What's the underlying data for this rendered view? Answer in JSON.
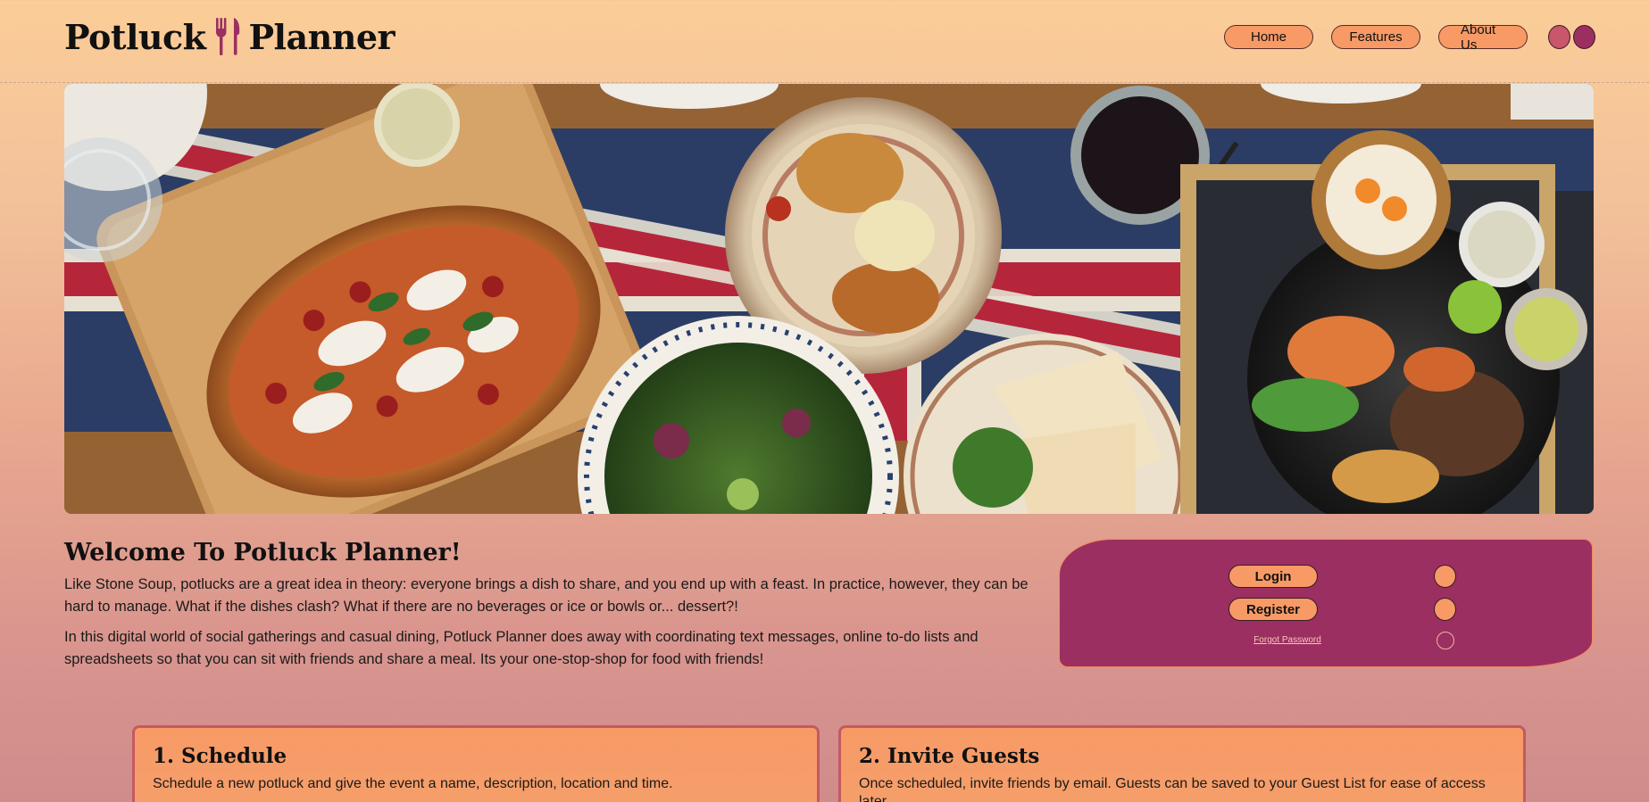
{
  "header": {
    "logo_left": "Potluck",
    "logo_right": "Planner"
  },
  "nav": {
    "items": [
      {
        "label": "Home"
      },
      {
        "label": "Features"
      },
      {
        "label": "About Us"
      }
    ],
    "theme_swatches": [
      {
        "color": "#c9566b"
      },
      {
        "color": "#9b2f61"
      }
    ]
  },
  "hero": {
    "icon": "food-table-photo"
  },
  "welcome": {
    "title": "Welcome To Potluck Planner!",
    "paragraph1": "Like Stone Soup, potlucks are a great idea in theory: everyone brings a dish to share, and you end up with a feast. In practice, however, they can be hard to manage. What if the dishes clash? What if there are no beverages or ice or bowls or... dessert?!",
    "paragraph2": "In this digital world of social gatherings and casual dining, Potluck Planner does away with coordinating text messages, online to-do lists and spreadsheets so that you can sit with friends and share a meal. Its your one-stop-shop for food with friends!"
  },
  "auth": {
    "login_label": "Login",
    "register_label": "Register",
    "forgot_label": "Forgot Password"
  },
  "steps": [
    {
      "title": "1. Schedule",
      "description": "Schedule a new potluck and give the event a name, description, location and time."
    },
    {
      "title": "2. Invite Guests",
      "description": "Once scheduled, invite friends by email. Guests can be saved to your Guest List for ease of access later."
    }
  ],
  "colors": {
    "accent": "#f79a66",
    "brand_purple": "#9b2f61",
    "card_border": "#c35a63"
  }
}
